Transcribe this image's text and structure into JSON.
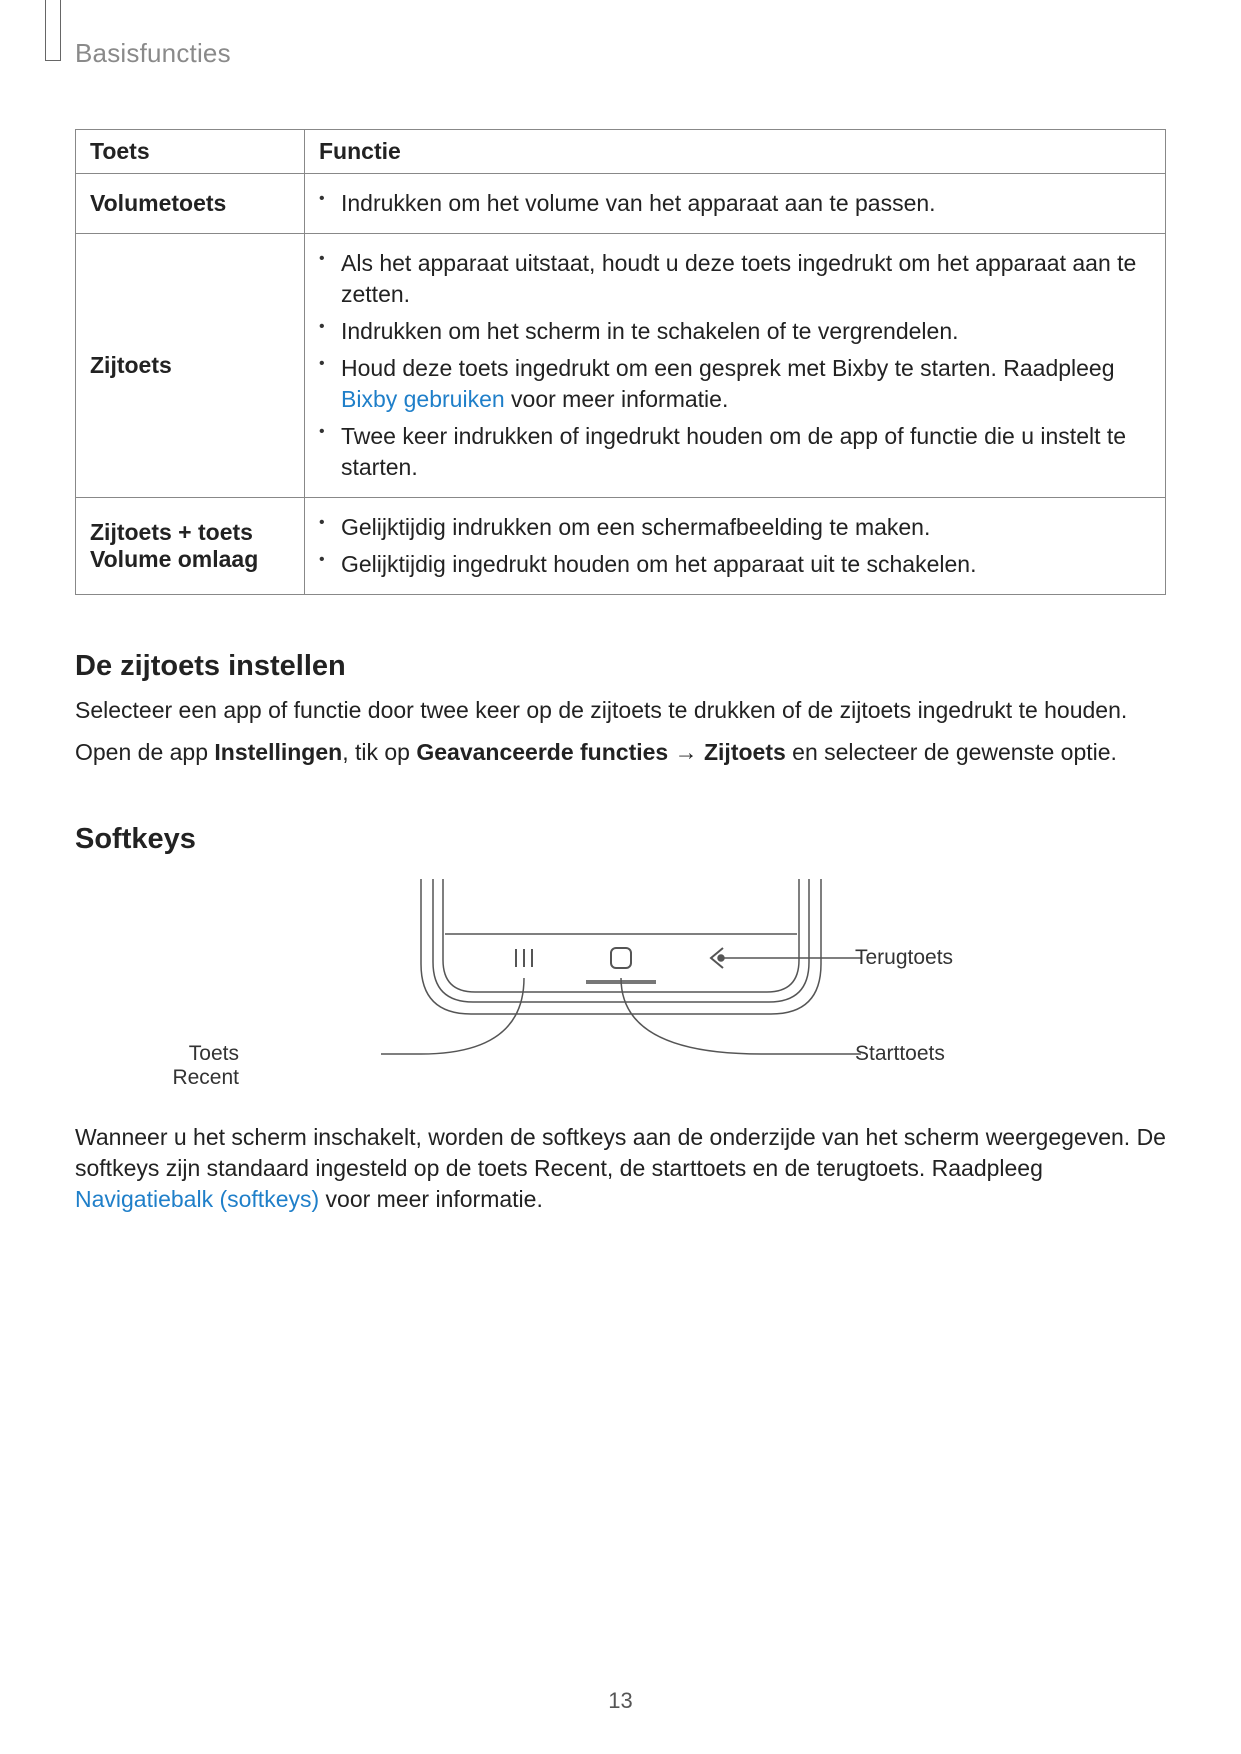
{
  "header": {
    "breadcrumb": "Basisfuncties"
  },
  "table": {
    "col1": "Toets",
    "col2": "Functie",
    "rows": [
      {
        "label": "Volumetoets",
        "items": [
          {
            "text": "Indrukken om het volume van het apparaat aan te passen."
          }
        ]
      },
      {
        "label": "Zijtoets",
        "items": [
          {
            "text": "Als het apparaat uitstaat, houdt u deze toets ingedrukt om het apparaat aan te zetten."
          },
          {
            "text": "Indrukken om het scherm in te schakelen of te vergrendelen."
          },
          {
            "pre": "Houd deze toets ingedrukt om een gesprek met Bixby te starten. Raadpleeg ",
            "link": "Bixby gebruiken",
            "post": " voor meer informatie."
          },
          {
            "text": "Twee keer indrukken of ingedrukt houden om de app of functie die u instelt te starten."
          }
        ]
      },
      {
        "label": "Zijtoets + toets Volume omlaag",
        "items": [
          {
            "text": "Gelijktijdig indrukken om een schermafbeelding te maken."
          },
          {
            "text": "Gelijktijdig ingedrukt houden om het apparaat uit te schakelen."
          }
        ]
      }
    ]
  },
  "section1": {
    "title": "De zijtoets instellen",
    "p1": "Selecteer een app of functie door twee keer op de zijtoets te drukken of de zijtoets ingedrukt te houden.",
    "p2_pre": "Open de app ",
    "p2_b1": "Instellingen",
    "p2_mid": ", tik op ",
    "p2_b2": "Geavanceerde functies",
    "p2_arrow": " → ",
    "p2_b3": "Zijtoets",
    "p2_post": " en selecteer de gewenste optie."
  },
  "section2": {
    "title": "Softkeys",
    "labels": {
      "back": "Terugtoets",
      "home": "Starttoets",
      "recent": "Toets Recent"
    },
    "p1_pre": "Wanneer u het scherm inschakelt, worden de softkeys aan de onderzijde van het scherm weergegeven. De softkeys zijn standaard ingesteld op de toets Recent, de starttoets en de terugtoets. Raadpleeg ",
    "p1_link": "Navigatiebalk (softkeys)",
    "p1_post": " voor meer informatie."
  },
  "pageNumber": "13"
}
